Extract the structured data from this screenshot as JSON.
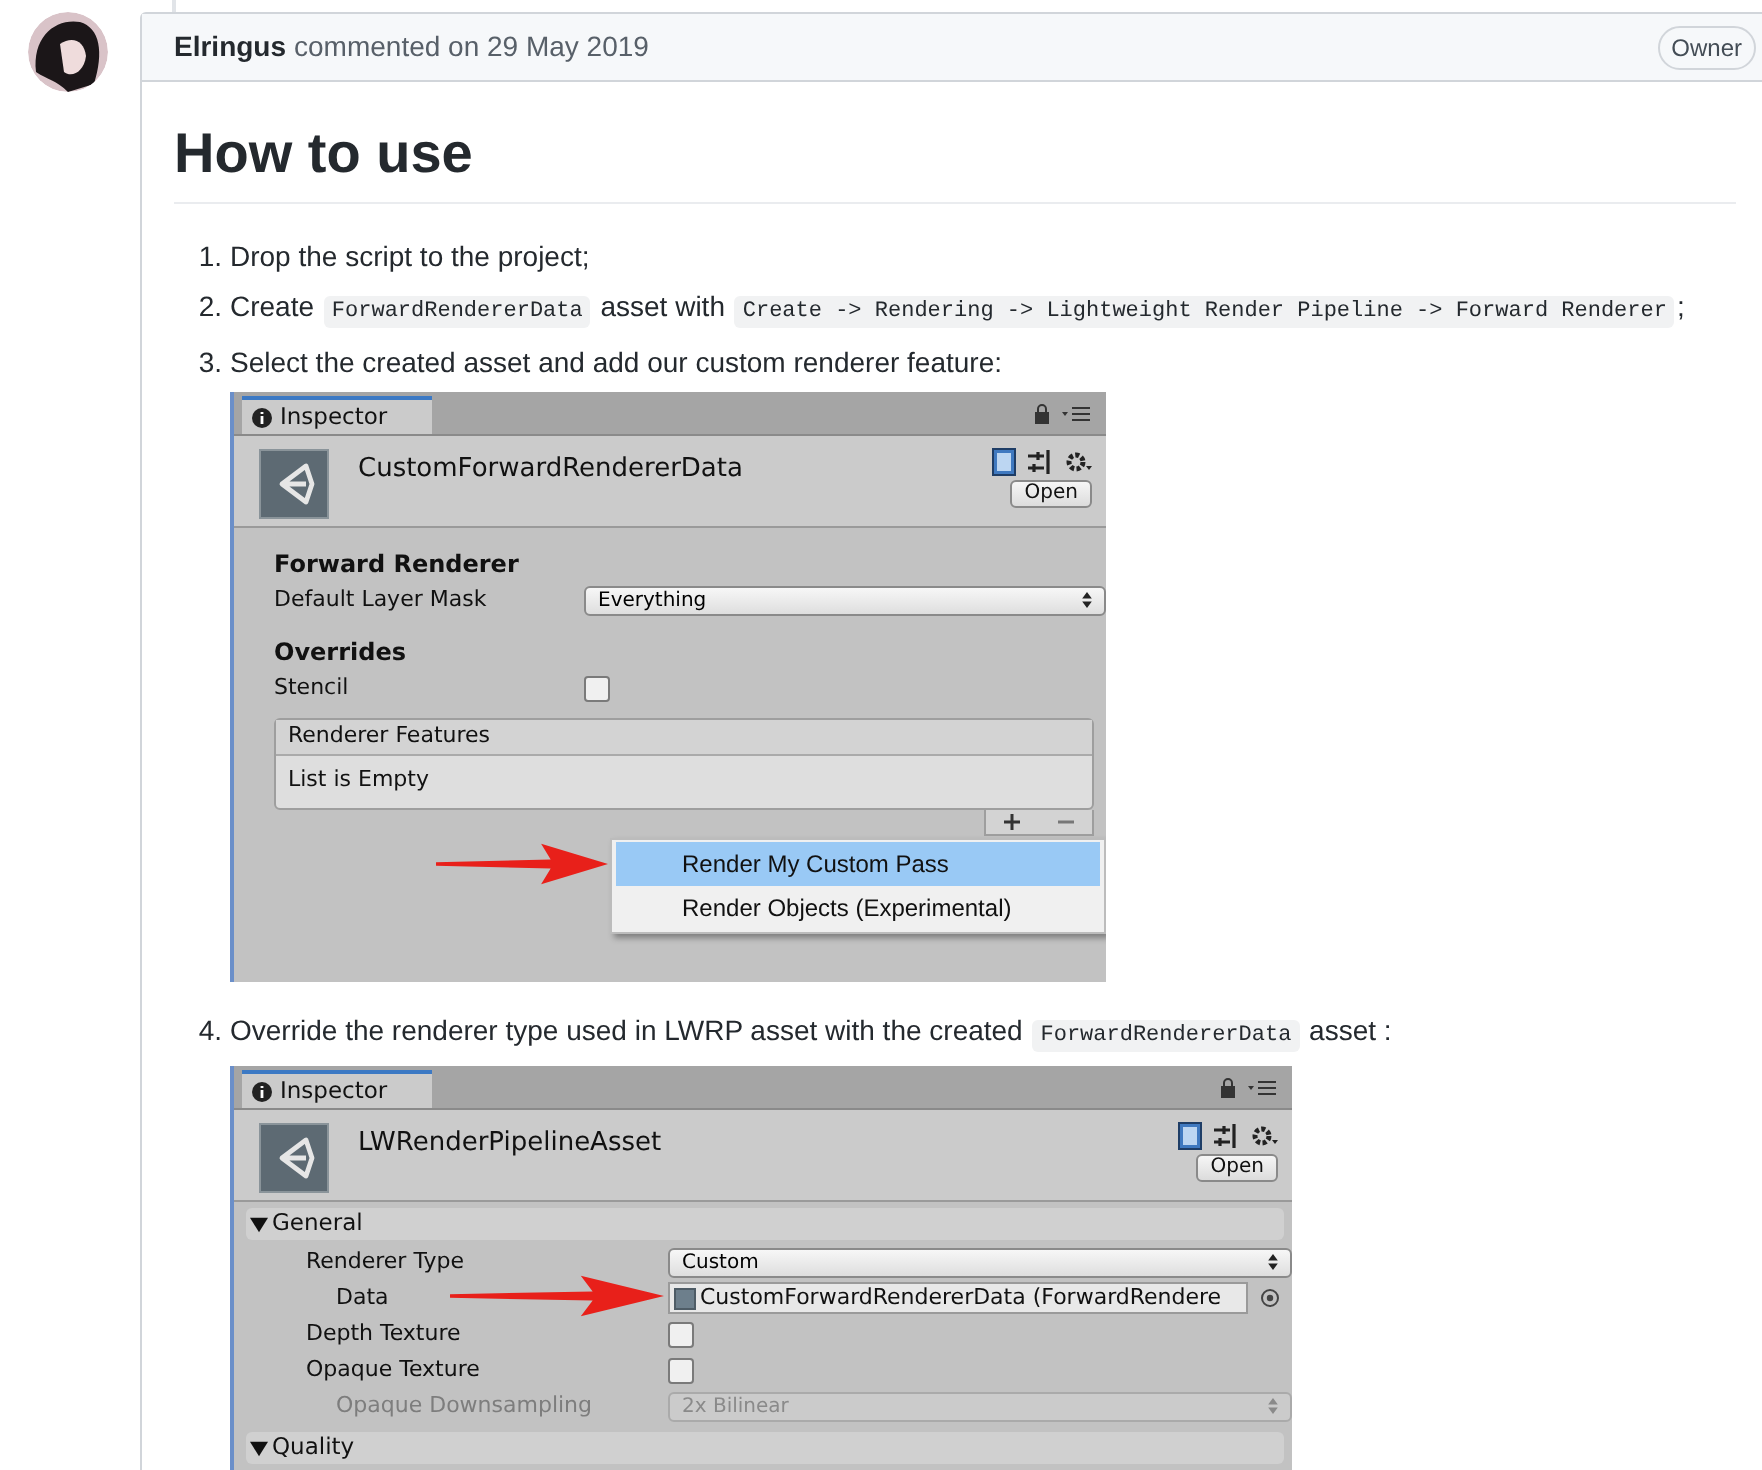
{
  "comment": {
    "author": "Elringus",
    "action": "commented on 29 May 2019",
    "badge": "Owner"
  },
  "heading": "How to use",
  "steps": [
    {
      "number": "1.",
      "parts": [
        {
          "kind": "text",
          "text": "Drop the script to the project;"
        }
      ]
    },
    {
      "number": "2.",
      "parts": [
        {
          "kind": "text",
          "text": "Create "
        },
        {
          "kind": "code",
          "text": "ForwardRendererData"
        },
        {
          "kind": "text",
          "text": " asset with "
        },
        {
          "kind": "code",
          "text": "Create -> Rendering -> Lightweight Render Pipeline -> Forward Renderer"
        },
        {
          "kind": "text",
          "text": ";"
        }
      ]
    },
    {
      "number": "3.",
      "parts": [
        {
          "kind": "text",
          "text": "Select the created asset and add our custom renderer feature:"
        }
      ],
      "inspector": {
        "tab": "Inspector",
        "asset": "CustomForwardRendererData",
        "open_button": "Open",
        "rows": [
          {
            "kind": "heading",
            "label": "Forward Renderer"
          },
          {
            "kind": "dropdown",
            "label": "Default Layer Mask",
            "value": "Everything",
            "disabled": false
          },
          {
            "kind": "heading",
            "label": "Overrides"
          },
          {
            "kind": "checkbox",
            "label": "Stencil",
            "checked": false
          },
          {
            "kind": "list",
            "title": "Renderer Features",
            "empty_text": "List is Empty"
          }
        ],
        "menu": [
          {
            "label": "Render My Custom Pass",
            "selected": true
          },
          {
            "label": "Render Objects (Experimental)",
            "selected": false
          }
        ]
      }
    },
    {
      "number": "4.",
      "parts": [
        {
          "kind": "text",
          "text": "Override the renderer type used in LWRP asset with the created "
        },
        {
          "kind": "code",
          "text": "ForwardRendererData"
        },
        {
          "kind": "text",
          "text": " asset :"
        }
      ],
      "inspector": {
        "tab": "Inspector",
        "asset": "LWRenderPipelineAsset",
        "open_button": "Open",
        "rows": [
          {
            "kind": "foldout",
            "label": "General",
            "expanded": true,
            "children": [
              {
                "kind": "dropdown",
                "label": "Renderer Type",
                "value": "Custom",
                "disabled": false,
                "children": [
                  {
                    "kind": "object",
                    "label": "Data",
                    "value": "CustomForwardRendererData (ForwardRendere"
                  }
                ]
              },
              {
                "kind": "checkbox",
                "label": "Depth Texture",
                "checked": false
              },
              {
                "kind": "checkbox",
                "label": "Opaque Texture",
                "checked": false,
                "children": [
                  {
                    "kind": "dropdown",
                    "label": "Opaque Downsampling",
                    "value": "2x Bilinear",
                    "disabled": true
                  }
                ]
              }
            ]
          },
          {
            "kind": "foldout",
            "label": "Quality",
            "expanded": true
          }
        ]
      }
    }
  ]
}
